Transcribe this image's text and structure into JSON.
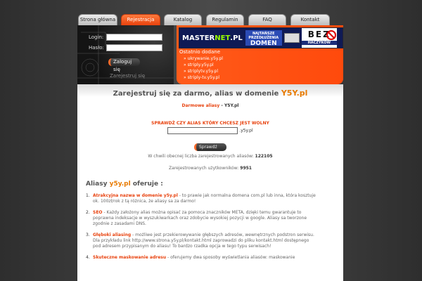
{
  "nav": {
    "tabs": [
      {
        "label": "Strona główna",
        "active": false
      },
      {
        "label": "Rejestracja",
        "active": true
      },
      {
        "label": "Katalog",
        "active": false
      },
      {
        "label": "Regulamin",
        "active": false
      },
      {
        "label": "FAQ",
        "active": false
      },
      {
        "label": "Kontakt",
        "active": false
      }
    ]
  },
  "login": {
    "login_label": "Login:",
    "password_label": "Hasło:",
    "login_value": "",
    "password_value": "",
    "submit_label": "Zaloguj się",
    "register_link": "Zarejestruj się"
  },
  "banner": {
    "logo_part1": "MASTER",
    "logo_part2": "NET",
    "logo_part3": ".PL",
    "promo_line1": "NAJTAŃSZE",
    "promo_line2": "PRZEDŁUŻENIA",
    "promo_line3": "DOMEN",
    "bez": "BEZ",
    "bez_sub": "HACZYKÓW"
  },
  "news": {
    "title": "Ostatnio dodane",
    "items": [
      "ukrywanie.y5y.pl",
      "striply.y5y.pl",
      "striplytv.y5y.pl",
      "striply-tv.y5y.pl"
    ]
  },
  "main": {
    "heading_text": "Zarejestruj się za darmo, alias w domenie",
    "heading_brand": "Y5Y.pl",
    "sub_highlight": "Darmowe aliasy",
    "sub_text": " - Y5Y.pl",
    "check_title": "SPRAWDŹ CZY ALIAS KTÓRY CHCESZ JEST WOLNY",
    "check_value": "",
    "check_suffix": ".y5y.pl",
    "check_button": "Sprawdź",
    "stat1_text": "W chwili obecnej liczba zarejestrowanych aliasów:",
    "stat1_value": "122105",
    "stat2_text": "Zarejestrowanych użytkowników:",
    "stat2_value": "9951",
    "offer_prefix": "Aliasy",
    "offer_brand": "y5y.pl",
    "offer_suffix": "oferuje :"
  },
  "features": [
    {
      "num": "1.",
      "keyword": "Atrakcyjna nazwa w domenie y5y.pl",
      "text": " - to prawie jak normalna domena com.pl lub inna, która kosztuje ok. 100zł/rok z tą różnica, że aliasy sa  za darmo!"
    },
    {
      "num": "2.",
      "keyword": "SEO",
      "text": " - Każdy założony alias można opisać za pomoca znaczników META, dzięki temu gwarantuje to poprawna indeksacje w wyszukiwarkach oraz zdobycie wysokiej pozycji w google. Aliasy sa tworzone zgodnie z zasadami DNS."
    },
    {
      "num": "3.",
      "keyword": "Głęboki aliasing",
      "text": " - możliwe jest przekierowywanie głębszych adresów, wewnętrznych podstron serwisu. Dla przykładu link http://www.strona.y5y.pl/kontakt.html zaprowadzi do pliku kontakt.html dostępnego pod adresem przypisanym do aliasu! To bardzo rzadka opcja w tego typu serwisach!"
    },
    {
      "num": "4.",
      "keyword": "Skuteczne maskowanie adresu",
      "text": " - oferujemy dwa sposoby wyświetlania aliasów: maskowanie"
    }
  ],
  "colors": {
    "accent": "#e8420e",
    "brand": "#e87a00",
    "background": "#3c3c3c"
  }
}
